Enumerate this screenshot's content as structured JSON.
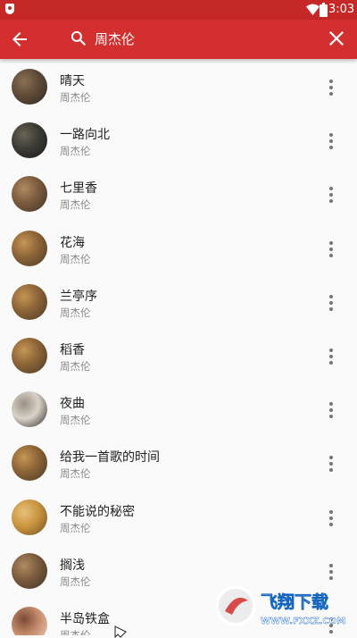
{
  "status_bar": {
    "time": "3:03"
  },
  "app_bar": {
    "back_icon": "arrow-left-icon",
    "search_icon": "search-icon",
    "search_value": "周杰伦",
    "close_icon": "close-icon"
  },
  "songs": [
    {
      "title": "晴天",
      "artist": "周杰伦",
      "cover": [
        "#5f4a38",
        "#2e2a22",
        "#8a7154"
      ]
    },
    {
      "title": "一路向北",
      "artist": "周杰伦",
      "cover": [
        "#3c3a35",
        "#1a1a1a",
        "#6b6456"
      ]
    },
    {
      "title": "七里香",
      "artist": "周杰伦",
      "cover": [
        "#7a5a3d",
        "#3f3328",
        "#b08b62"
      ]
    },
    {
      "title": "花海",
      "artist": "周杰伦",
      "cover": [
        "#8b6338",
        "#4a3a22",
        "#c49552"
      ]
    },
    {
      "title": "兰亭序",
      "artist": "周杰伦",
      "cover": [
        "#8b6338",
        "#4a3a22",
        "#c49552"
      ]
    },
    {
      "title": "稻香",
      "artist": "周杰伦",
      "cover": [
        "#8b6338",
        "#4a3a22",
        "#c49552"
      ]
    },
    {
      "title": "夜曲",
      "artist": "周杰伦",
      "cover": [
        "#d8d2c8",
        "#2a2624",
        "#9a8f82"
      ]
    },
    {
      "title": "给我一首歌的时间",
      "artist": "周杰伦",
      "cover": [
        "#8b6338",
        "#4a3a22",
        "#c49552"
      ]
    },
    {
      "title": "不能说的秘密",
      "artist": "周杰伦",
      "cover": [
        "#c9953f",
        "#6e4f24",
        "#e8c07a"
      ]
    },
    {
      "title": "搁浅",
      "artist": "周杰伦",
      "cover": [
        "#7a5a3d",
        "#3f3328",
        "#b08b62"
      ]
    },
    {
      "title": "半岛铁盒",
      "artist": "周杰伦",
      "cover": [
        "#c48a6a",
        "#f1d3c0",
        "#7a4a35"
      ]
    }
  ],
  "more_icon": "more-vert-icon",
  "watermark": {
    "text_main": "飞翔下载",
    "text_url": "WWW.FXXZ.COM"
  },
  "colors": {
    "app_bar": "#d32f2f",
    "status_bar": "#c62828",
    "background": "#fafafa"
  }
}
